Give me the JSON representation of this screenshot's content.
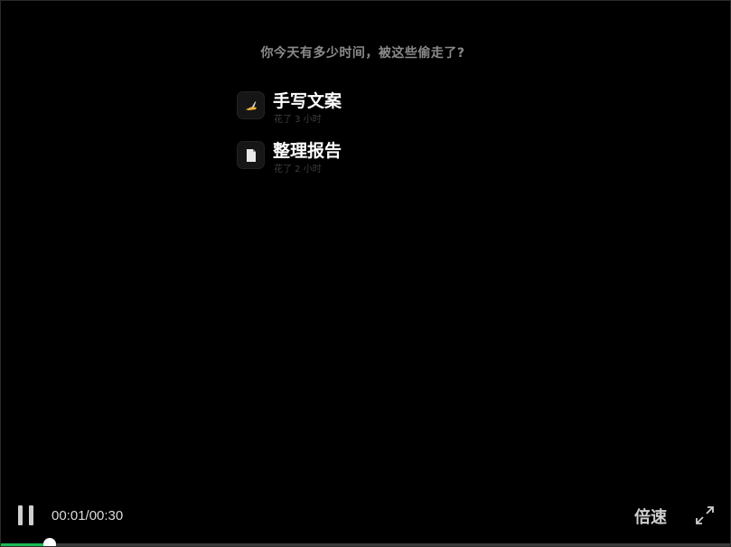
{
  "prompt": {
    "question": "你今天有多少时间，被这些偷走了?"
  },
  "tasks": [
    {
      "title": "手写文案",
      "subtitle": "花了 3 小时",
      "icon": "writing-hand-icon"
    },
    {
      "title": "整理报告",
      "subtitle": "花了 2 小时",
      "icon": "document-icon"
    }
  ],
  "controls": {
    "pause_icon": "pause-icon",
    "time": "00:01/00:30",
    "speed_label": "倍速",
    "fullscreen_icon": "fullscreen-icon"
  },
  "progress": {
    "fraction": 0.0667,
    "fill_color": "#1db954"
  },
  "colors": {
    "background": "#000000",
    "accent": "#1db954"
  }
}
